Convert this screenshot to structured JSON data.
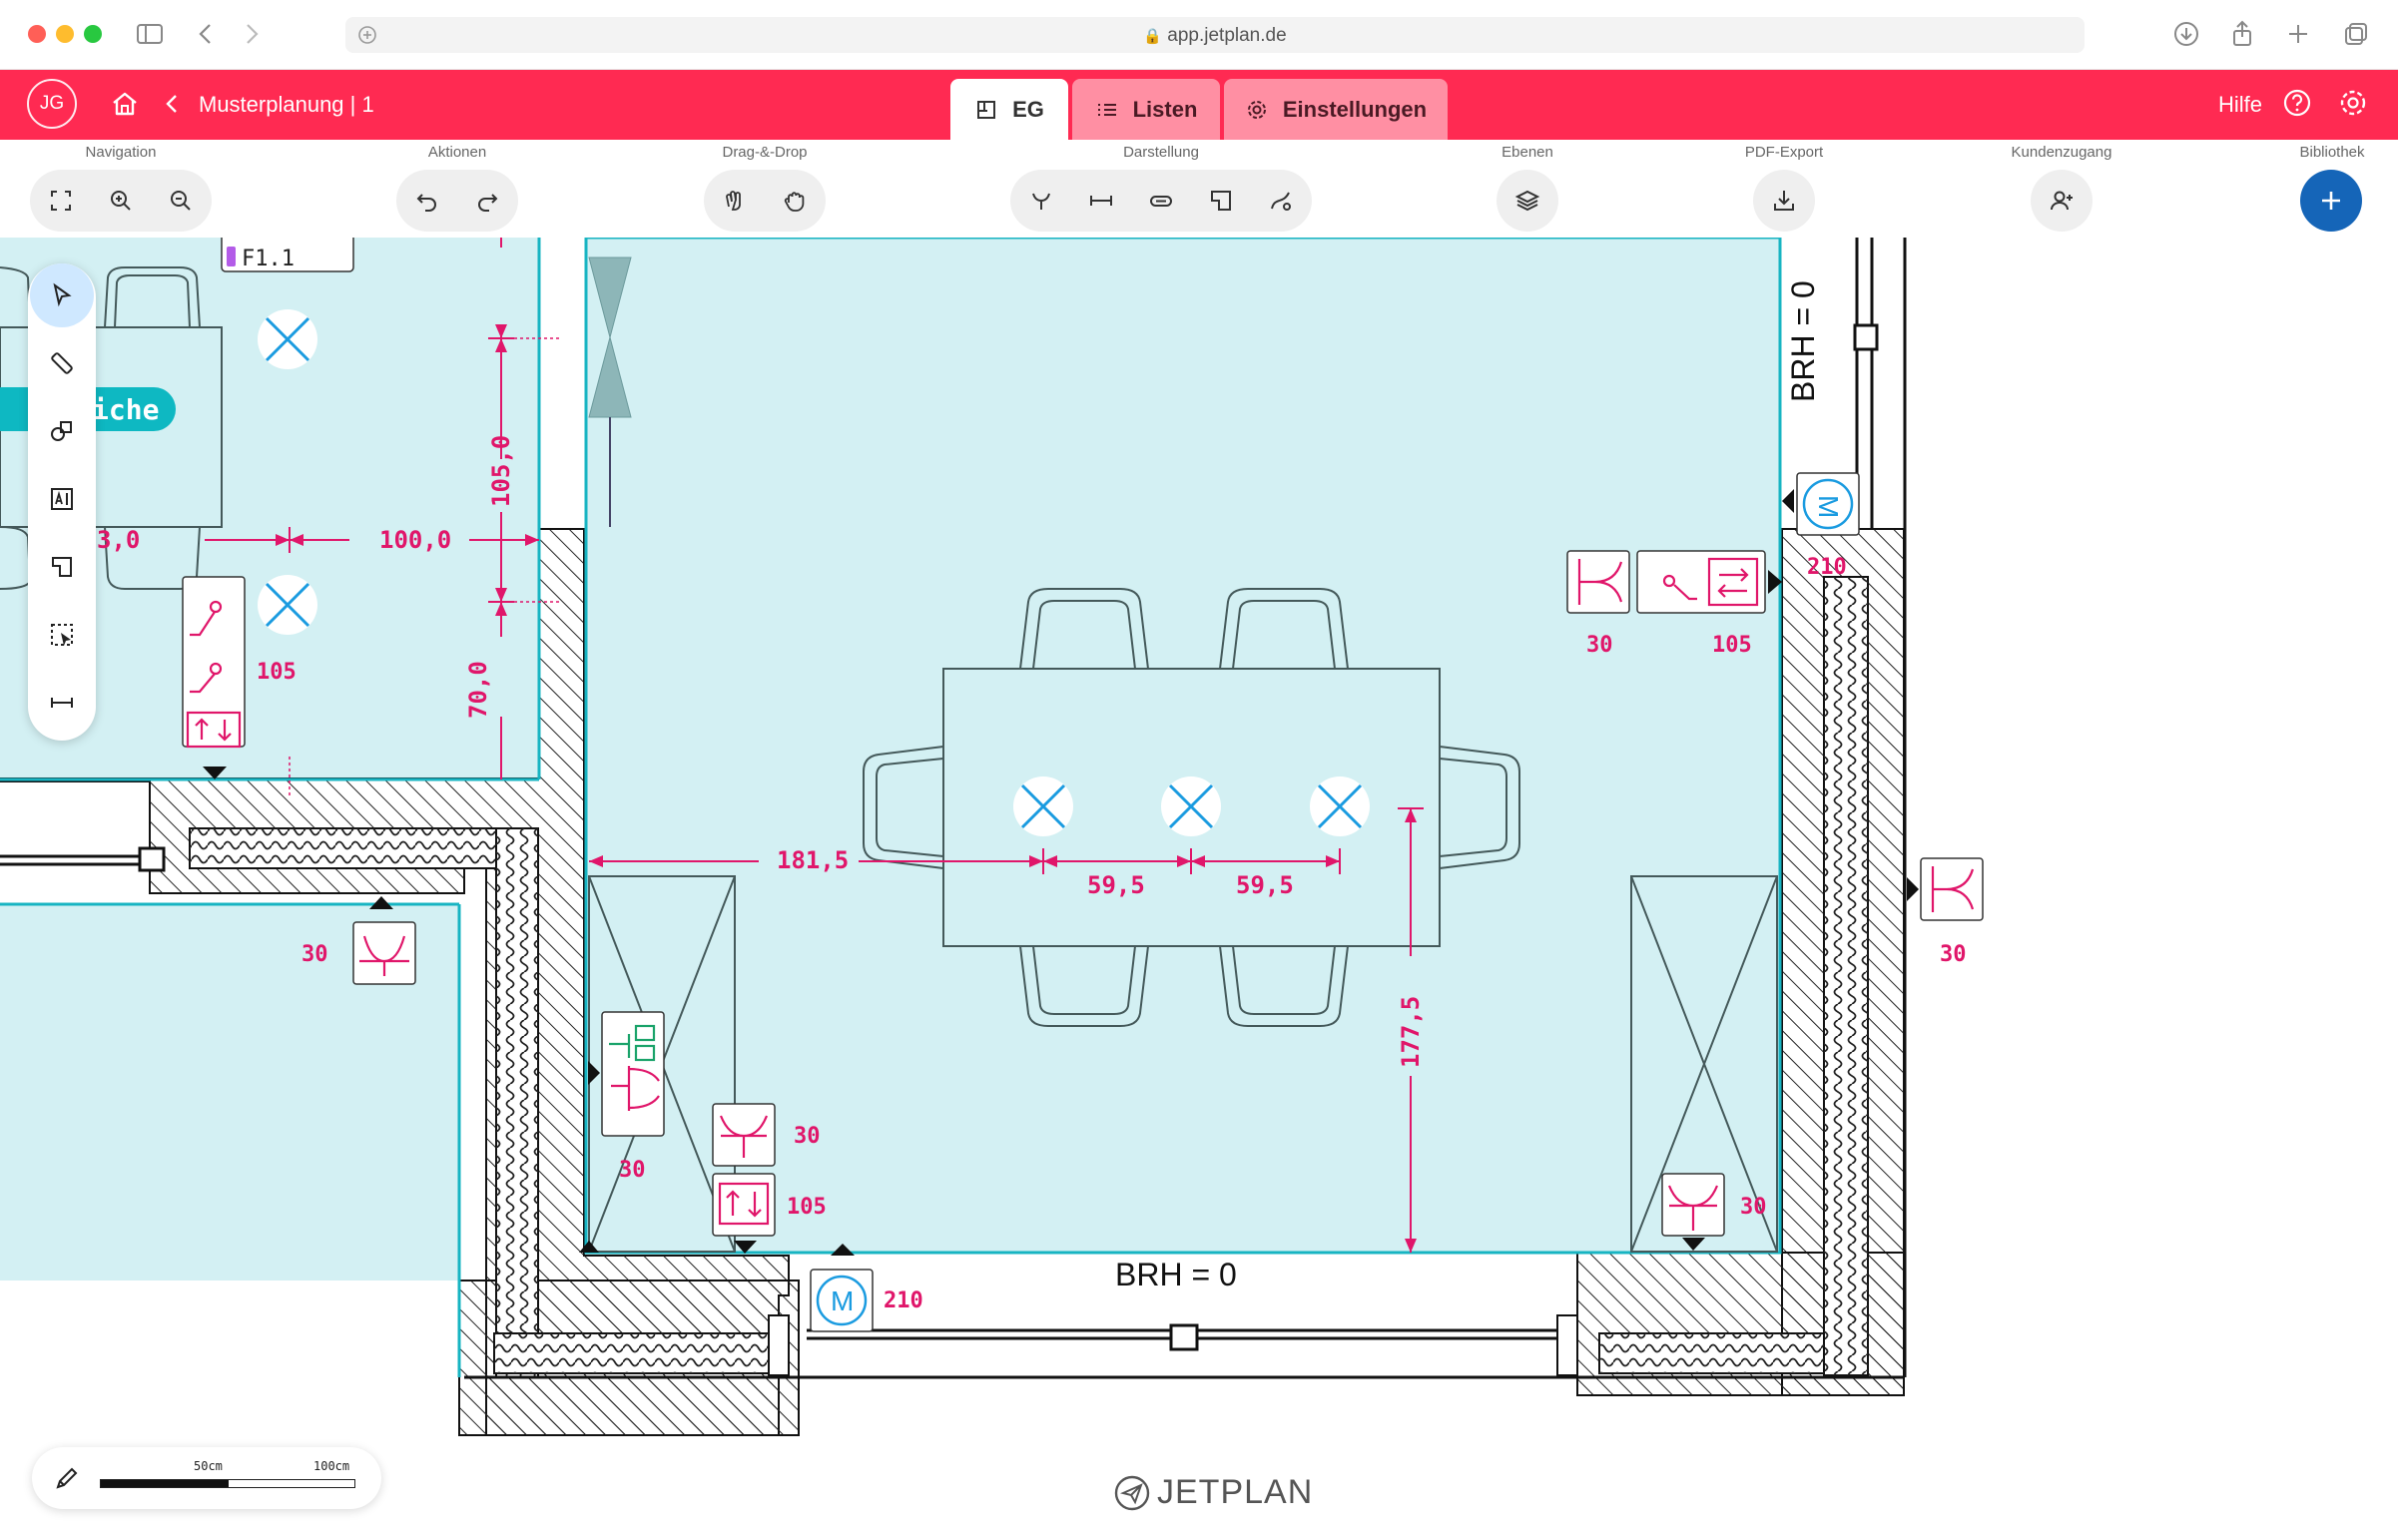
{
  "browser": {
    "url": "app.jetplan.de"
  },
  "header": {
    "avatar_initials": "JG",
    "project_title": "Musterplanung | 1",
    "tabs": [
      {
        "label": "EG",
        "active": true
      },
      {
        "label": "Listen",
        "active": false
      },
      {
        "label": "Einstellungen",
        "active": false
      }
    ],
    "help_label": "Hilfe",
    "accent_color": "#ff2a52"
  },
  "toolbar": {
    "groups": {
      "navigation": "Navigation",
      "aktionen": "Aktionen",
      "dragdrop": "Drag-&-Drop",
      "darstellung": "Darstellung",
      "ebenen": "Ebenen",
      "pdfexport": "PDF-Export",
      "kundenzugang": "Kundenzugang",
      "bibliothek": "Bibliothek"
    }
  },
  "plan": {
    "room_label": "F1.1",
    "room_badge": "iche",
    "brh_right": "BRH = 0",
    "brh_bottom": "BRH = 0",
    "dims": {
      "d_30": "3,0",
      "d_100": "100,0",
      "d_105": "105,0",
      "d_70": "70,0",
      "d_1815": "181,5",
      "d_595a": "59,5",
      "d_595b": "59,5",
      "d_1775": "177,5"
    },
    "heights": {
      "h_105_left": "105",
      "h_30_left": "30",
      "h_30_lower": "30",
      "h_30_mid": "30",
      "h_105_mid": "105",
      "h_210_bottom": "210",
      "h_30_right_a": "30",
      "h_105_right": "105",
      "h_210_right": "210",
      "h_30_far_right": "30",
      "h_30_corner": "30"
    },
    "motor_letter": "M"
  },
  "scale": {
    "label_50": "50cm",
    "label_100": "100cm"
  },
  "brand": {
    "name": "JETPLAN"
  }
}
